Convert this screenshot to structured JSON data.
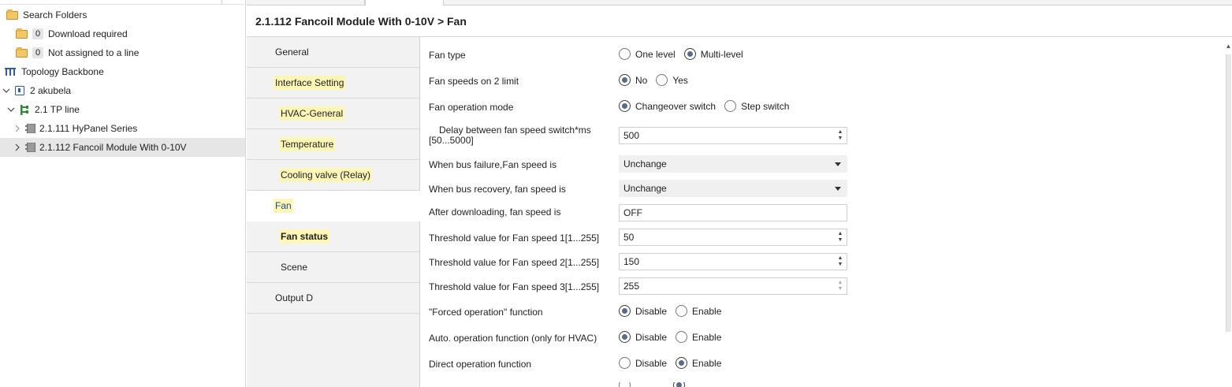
{
  "tree": {
    "items": [
      {
        "label": "Search Folders",
        "badge": ""
      },
      {
        "label": "Download required",
        "badge": "0"
      },
      {
        "label": "Not assigned to a line",
        "badge": "0"
      },
      {
        "label": "Topology Backbone",
        "badge": ""
      },
      {
        "label": "2 akubela",
        "badge": ""
      },
      {
        "label": "2.1 TP line",
        "badge": ""
      },
      {
        "label": "2.1.111 HyPanel Series",
        "badge": ""
      },
      {
        "label": "2.1.112 Fancoil Module With 0-10V",
        "badge": ""
      }
    ]
  },
  "header": {
    "title": "2.1.112 Fancoil Module With 0-10V > Fan"
  },
  "nav": {
    "items": [
      {
        "label": "General"
      },
      {
        "label": "Interface Setting"
      },
      {
        "label": "HVAC-General"
      },
      {
        "label": "Temperature"
      },
      {
        "label": "Cooling valve (Relay)"
      },
      {
        "label": "Fan"
      },
      {
        "label": "Fan status"
      },
      {
        "label": "Scene"
      },
      {
        "label": "Output D"
      }
    ]
  },
  "params": {
    "fan_type": {
      "label": "Fan type",
      "opt1": "One level",
      "opt2": "Multi-level"
    },
    "fan_speeds_limit": {
      "label": "Fan speeds on 2 limit",
      "opt1": "No",
      "opt2": "Yes"
    },
    "fan_op_mode": {
      "label": "Fan operation mode",
      "opt1": "Changeover switch",
      "opt2": "Step switch"
    },
    "delay": {
      "label_line1": "Delay between fan speed switch*ms",
      "label_line2": "[50...5000]",
      "value": "500"
    },
    "bus_failure": {
      "label": "When bus failure,Fan speed is",
      "value": "Unchange"
    },
    "bus_recovery": {
      "label": "When bus recovery, fan speed is",
      "value": "Unchange"
    },
    "after_download": {
      "label": "After downloading, fan speed is",
      "value": "OFF"
    },
    "threshold1": {
      "label": "Threshold value for Fan speed 1[1...255]",
      "value": "50"
    },
    "threshold2": {
      "label": "Threshold value for Fan speed 2[1...255]",
      "value": "150"
    },
    "threshold3": {
      "label": "Threshold value for Fan speed 3[1...255]",
      "value": "255"
    },
    "forced_op": {
      "label": "\"Forced operation\" function",
      "opt1": "Disable",
      "opt2": "Enable"
    },
    "auto_op": {
      "label": "Auto. operation function (only for HVAC)",
      "opt1": "Disable",
      "opt2": "Enable"
    },
    "direct_op": {
      "label": "Direct operation function",
      "opt1": "Disable",
      "opt2": "Enable"
    }
  },
  "colors": {
    "highlight": "#fdf6b7",
    "accent": "#1a4f8a",
    "selection": "#e6e6e6"
  }
}
